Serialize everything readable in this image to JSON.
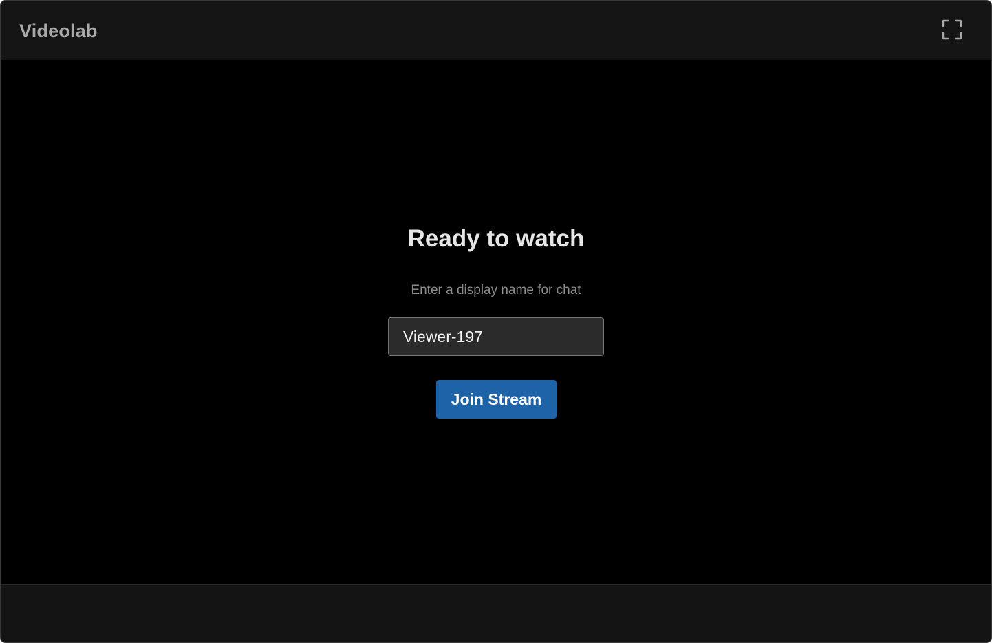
{
  "app": {
    "title": "Videolab"
  },
  "header": {
    "fullscreen_icon": "fullscreen-icon"
  },
  "join": {
    "title": "Ready to watch",
    "subtitle": "Enter a display name for chat",
    "name_value": "Viewer-197",
    "button_label": "Join Stream"
  },
  "colors": {
    "background": "#000000",
    "header": "#151515",
    "accent": "#1e63a8",
    "title_text": "#e6e6e6",
    "subtitle_text": "#8c8c8c"
  }
}
